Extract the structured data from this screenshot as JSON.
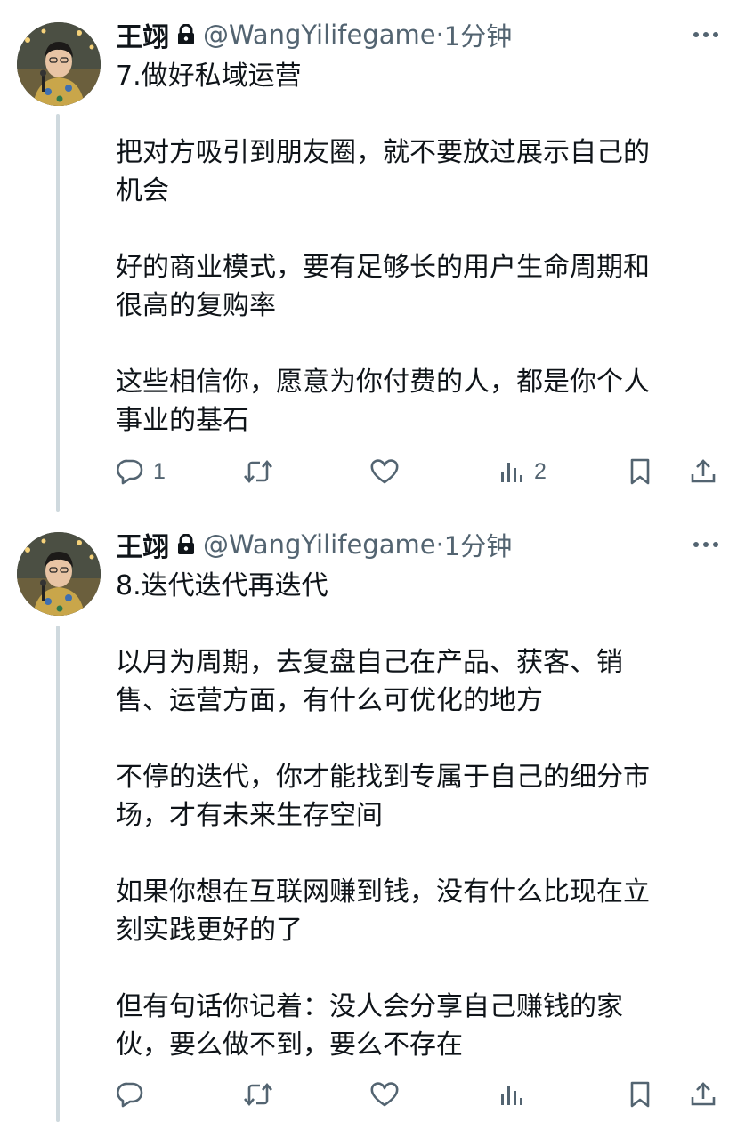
{
  "tweets": [
    {
      "author": {
        "name": "王翊",
        "handle": "@WangYilifegame",
        "separator": "·",
        "time": "1分钟"
      },
      "lines": [
        [
          "7.做好私域运营"
        ],
        [
          "把对方吸引到朋友圈，就不要放过展示自己的",
          "机会"
        ],
        [
          "好的商业模式，要有足够长的用户生命周期和",
          "很高的复购率"
        ],
        [
          "这些相信你，愿意为你付费的人，都是你个人",
          "事业的基石"
        ]
      ],
      "actions": {
        "reply_count": "1",
        "retweet_count": "",
        "like_count": "",
        "views_count": "2"
      }
    },
    {
      "author": {
        "name": "王翊",
        "handle": "@WangYilifegame",
        "separator": "·",
        "time": "1分钟"
      },
      "lines": [
        [
          "8.迭代迭代再迭代"
        ],
        [
          "以月为周期，去复盘自己在产品、获客、销",
          "售、运营方面，有什么可优化的地方"
        ],
        [
          "不停的迭代，你才能找到专属于自己的细分市",
          "场，才有未来生存空间"
        ],
        [
          "如果你想在互联网赚到钱，没有什么比现在立",
          "刻实践更好的了"
        ],
        [
          "但有句话你记着：没人会分享自己赚钱的家",
          "伙，要么做不到，要么不存在"
        ]
      ],
      "actions": {
        "reply_count": "",
        "retweet_count": "",
        "like_count": "",
        "views_count": ""
      }
    }
  ],
  "icons": {
    "lock": "lock-icon",
    "more": "more-icon",
    "reply": "reply-icon",
    "retweet": "retweet-icon",
    "like": "like-icon",
    "views": "views-icon",
    "bookmark": "bookmark-icon",
    "share": "share-icon"
  },
  "colors": {
    "text": "#0f1419",
    "secondary": "#536471",
    "thread_line": "#cfd9de"
  }
}
